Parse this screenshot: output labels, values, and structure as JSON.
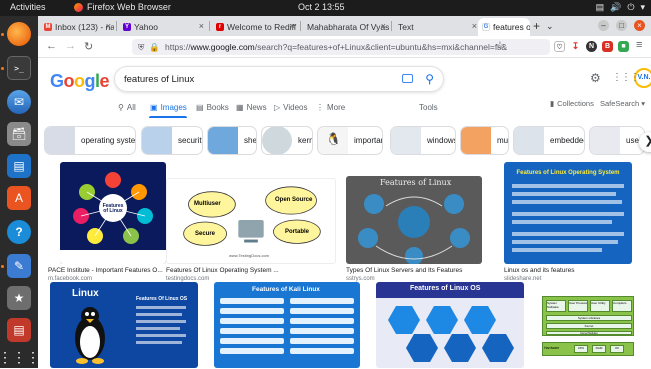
{
  "topbar": {
    "activities": "Activities",
    "app_name": "Firefox Web Browser",
    "clock": "Oct 2  13:55"
  },
  "tabs": [
    {
      "label": "Inbox (123) - nagar",
      "favicon": "gmail-icon",
      "color": "#ea4335",
      "glyph": "M"
    },
    {
      "label": "Yahoo",
      "favicon": "yahoo-icon",
      "color": "#6001d2",
      "glyph": "Y"
    },
    {
      "label": "Welcome to Rediff",
      "favicon": "rediff-icon",
      "color": "#e00000",
      "glyph": "r"
    },
    {
      "label": "Mahabharata Of Vyas",
      "favicon": "",
      "color": "",
      "glyph": ""
    },
    {
      "label": "Text",
      "favicon": "",
      "color": "",
      "glyph": ""
    },
    {
      "label": "features of Linux - G",
      "favicon": "google-icon",
      "color": "#4285f4",
      "glyph": "G"
    }
  ],
  "navbar": {
    "url_prefix": "https://",
    "url_domain": "www.google.com",
    "url_rest": "/search?q=features+of+Linux&client=ubuntu&hs=mxi&channel=fs&"
  },
  "google": {
    "logo": "Google",
    "query": "features of Linux",
    "avatar": "V.N."
  },
  "search_tabs": [
    {
      "label": "All",
      "icon": "search-icon"
    },
    {
      "label": "Images",
      "icon": "image-icon",
      "active": true
    },
    {
      "label": "Books",
      "icon": "book-icon"
    },
    {
      "label": "News",
      "icon": "news-icon"
    },
    {
      "label": "Videos",
      "icon": "video-icon"
    },
    {
      "label": "More",
      "icon": "more-icon"
    }
  ],
  "tools": "Tools",
  "collections": "Collections",
  "safesearch": "SafeSearch",
  "chips": [
    {
      "label": "operating system",
      "thumb_color": "#d8dce6"
    },
    {
      "label": "security",
      "thumb_color": "#b9d1ea"
    },
    {
      "label": "shell",
      "thumb_color": "#6fa8dc"
    },
    {
      "label": "kernel",
      "thumb_color": "#cfd8dc"
    },
    {
      "label": "important",
      "thumb_color": "#f5f5f5"
    },
    {
      "label": "windows",
      "thumb_color": "#e3e8ef"
    },
    {
      "label": "multi",
      "thumb_color": "#f4a261"
    },
    {
      "label": "embedded",
      "thumb_color": "#dde3ea"
    },
    {
      "label": "user",
      "thumb_color": "#e8eaf0"
    }
  ],
  "results": [
    {
      "title": "PACE Institute - Important Features O...",
      "source": "m.facebook.com",
      "img_text": "Features of Linux"
    },
    {
      "title": "Features Of Linux Operating System ...",
      "source": "testingdocs.com",
      "img_text": [
        "Multiuser",
        "Open Source",
        "Secure",
        "Portable"
      ],
      "watermark": "www.TestingDocs.com"
    },
    {
      "title": "Types Of Linux Servers and Its Features",
      "source": "sstrys.com",
      "img_text": "Features of Linux"
    },
    {
      "title": "Linux os and its features",
      "source": "slideshare.net",
      "img_text": "Features of Linux Operating System"
    },
    {
      "title": "",
      "source": "",
      "img_text": [
        "Linux",
        "Features Of Linux OS"
      ]
    },
    {
      "title": "",
      "source": "",
      "img_text": "Features of Kali Linux"
    },
    {
      "title": "",
      "source": "",
      "img_text": "Features of Linux OS"
    },
    {
      "title": "",
      "source": "",
      "img_text": [
        "System Software",
        "User Process",
        "User Utility",
        "Compilers",
        "System Libraries",
        "Kernel",
        "Kernel Modules",
        "Hardware",
        "CPU",
        "RAM",
        "I/O"
      ]
    }
  ]
}
